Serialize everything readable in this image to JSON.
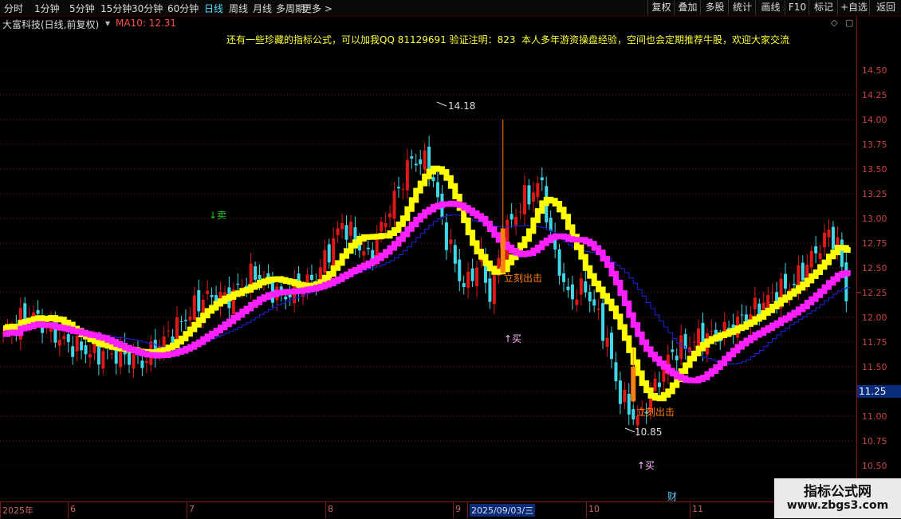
{
  "toolbar": {
    "timeframes": [
      "分时",
      "1分钟",
      "5分钟",
      "15分钟",
      "30分钟",
      "60分钟",
      "日线",
      "周线",
      "月线",
      "多周期",
      "更多"
    ],
    "active_timeframe": "日线",
    "right_buttons": [
      "复权",
      "叠加",
      "多股",
      "统计",
      "画线",
      "F10",
      "标记",
      "+自选",
      "返回"
    ]
  },
  "info": {
    "stock_title": "大富科技(日线,前复权)",
    "ma_label": "MA10: 12.31",
    "promo1": "还有一些珍藏的指标公式，可以加我QQ 81129691 验证注明：823",
    "promo2": "本人多年游资操盘经验，空间也会定期推荐牛股，欢迎大家交流"
  },
  "colors": {
    "up": "#e01818",
    "down": "#40d8e8",
    "yellow": "#ffff00",
    "magenta": "#ff20ff",
    "green_step": "#22cc22",
    "blue_step": "#2222dd",
    "orange": "#ff7f10",
    "grid": "#6e1414"
  },
  "chart_data": {
    "type": "candlestick",
    "y_ticks": [
      "14.50",
      "14.25",
      "14.00",
      "13.75",
      "13.50",
      "13.25",
      "13.00",
      "12.75",
      "12.50",
      "12.25",
      "12.00",
      "11.75",
      "11.50",
      "11.25",
      "11.00",
      "10.75",
      "10.50"
    ],
    "y_values": [
      14.5,
      14.25,
      14.0,
      13.75,
      13.5,
      13.25,
      13.0,
      12.75,
      12.5,
      12.25,
      12.0,
      11.75,
      11.5,
      11.25,
      11.0,
      10.75,
      10.5
    ],
    "ylim": [
      10.33,
      14.83
    ],
    "current_price": "11.25",
    "annotations": {
      "high_label": "14.18",
      "low_label": "10.85",
      "sell_label": "↓卖",
      "buy_label_1": "↑买",
      "buy_label_2": "↑买",
      "attack_label_1": "立刻出击",
      "attack_label_2": "立刻出击",
      "finance_marker": "财"
    },
    "x_labels": [
      "2025年",
      "6",
      "7",
      "8",
      "9",
      "2025/09/03/三",
      "10",
      "11"
    ],
    "keypoints": [
      [
        0,
        11.8
      ],
      [
        6,
        12.05
      ],
      [
        14,
        11.75
      ],
      [
        20,
        11.65
      ],
      [
        28,
        11.62
      ],
      [
        32,
        11.55
      ],
      [
        40,
        11.9
      ],
      [
        46,
        12.2
      ],
      [
        52,
        12.2
      ],
      [
        58,
        12.45
      ],
      [
        64,
        12.2
      ],
      [
        72,
        12.4
      ],
      [
        78,
        12.95
      ],
      [
        84,
        12.6
      ],
      [
        90,
        13.2
      ],
      [
        94,
        13.6
      ],
      [
        98,
        13.55
      ],
      [
        102,
        12.8
      ],
      [
        106,
        12.3
      ],
      [
        110,
        12.6
      ],
      [
        112,
        12.2
      ],
      [
        116,
        12.9
      ],
      [
        120,
        13.2
      ],
      [
        124,
        13.35
      ],
      [
        126,
        12.8
      ],
      [
        130,
        12.2
      ],
      [
        134,
        12.3
      ],
      [
        138,
        11.9
      ],
      [
        142,
        11.2
      ],
      [
        146,
        10.95
      ],
      [
        150,
        11.3
      ],
      [
        154,
        11.65
      ],
      [
        160,
        11.78
      ],
      [
        166,
        11.85
      ],
      [
        172,
        12.05
      ],
      [
        178,
        12.25
      ],
      [
        182,
        12.35
      ],
      [
        186,
        12.6
      ],
      [
        190,
        12.85
      ],
      [
        192,
        12.75
      ],
      [
        194,
        12.2
      ]
    ]
  },
  "watermark": {
    "line1": "指标公式网",
    "line2": "www.zbgs3.com"
  }
}
